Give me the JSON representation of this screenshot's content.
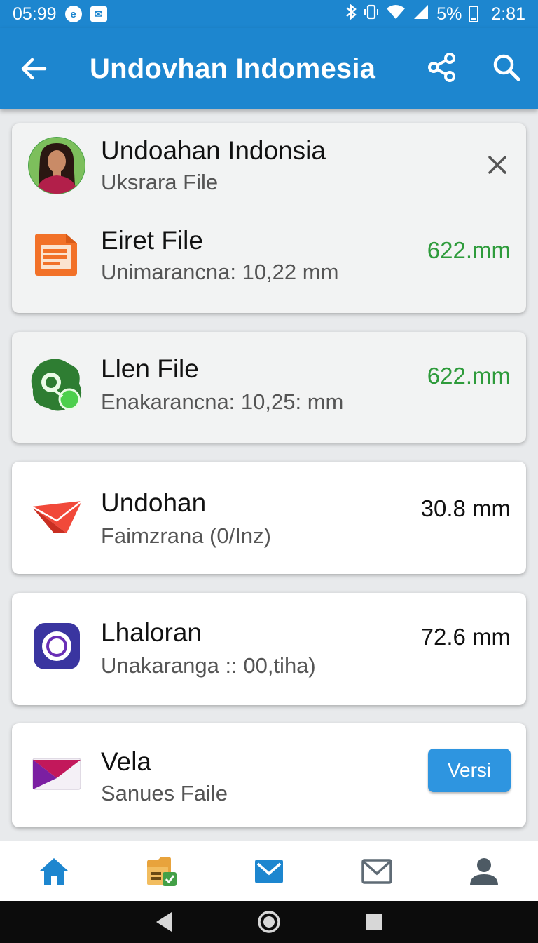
{
  "status_bar": {
    "time_left": "05:99",
    "badge_icon": "e",
    "mail_glyph": "✉",
    "battery_text": "5%",
    "clock": "2:81"
  },
  "app_bar": {
    "title": "Undovhan Indomesia"
  },
  "header_card": {
    "name": "Undoahan Indonsia",
    "subtitle": "Uksrara File"
  },
  "files": [
    {
      "name": "Eiret File",
      "subtitle": "Unimarancna:  10,22 mm",
      "size": "622.mm",
      "size_color": "#2e9b3b",
      "icon": "document-icon"
    },
    {
      "name": "Llen File",
      "subtitle": "Enakarancna:  10,25: mm",
      "size": "622.mm",
      "size_color": "#2e9b3b",
      "icon": "green-blob-icon"
    },
    {
      "name": "Undohan",
      "subtitle": "Faimzrana (0/Inz)",
      "size": "30.8 mm",
      "size_color": "#111111",
      "icon": "red-envelope-icon"
    },
    {
      "name": "Lhaloran",
      "subtitle": "Unakaranga :: 00,tiha)",
      "size": "72.6 mm",
      "size_color": "#111111",
      "icon": "purple-ring-icon"
    },
    {
      "name": "Vela",
      "subtitle": "Sanues Faile",
      "action_label": "Versi",
      "icon": "pink-envelope-icon"
    }
  ],
  "colors": {
    "primary": "#1d86cf",
    "accent_green": "#2e9b3b",
    "button_blue": "#2e95e0"
  },
  "bottom_nav": [
    "home-icon",
    "folder-icon",
    "inbox-icon",
    "mail-icon",
    "profile-icon"
  ],
  "system_nav": [
    "back-icon",
    "home-circle-icon",
    "recents-icon"
  ]
}
